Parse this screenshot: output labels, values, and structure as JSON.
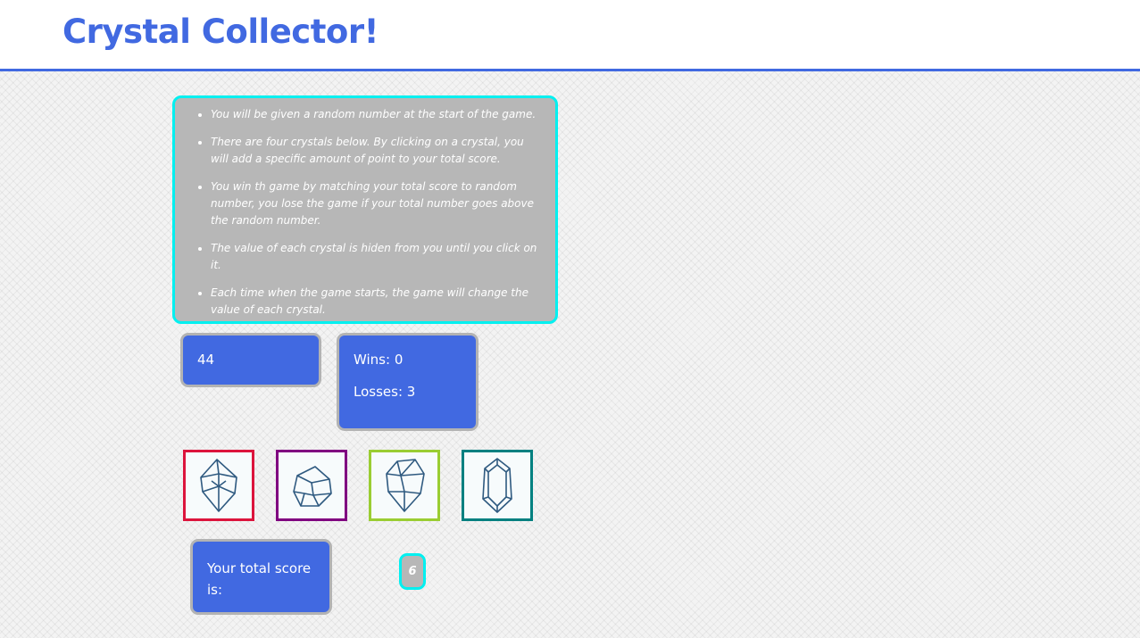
{
  "header": {
    "title": "Crystal Collector!",
    "accent_color": "#4169e1"
  },
  "instructions": {
    "items": [
      "You will be given a random number at the start of the game.",
      "There are four crystals below. By clicking on a crystal, you will add a specific amount of point to your total score.",
      "You win th game by matching your total score to random number, you lose the game if your total number goes above the random number.",
      "The value of each crystal is hiden from you until you click on it.",
      "Each time when the game starts, the game will change the value of each crystal."
    ]
  },
  "target": {
    "value": "44"
  },
  "scoreboard": {
    "wins": "Wins: 0",
    "losses": "Losses: 3"
  },
  "crystals": [
    {
      "name": "crystal-1",
      "icon": "crystal-icon",
      "border_color": "#dc143c"
    },
    {
      "name": "crystal-2",
      "icon": "crystal-icon",
      "border_color": "#800080"
    },
    {
      "name": "crystal-3",
      "icon": "crystal-icon",
      "border_color": "#9acd32"
    },
    {
      "name": "crystal-4",
      "icon": "crystal-icon",
      "border_color": "#008080"
    }
  ],
  "total": {
    "label": "Your total score is:",
    "value": "6"
  }
}
